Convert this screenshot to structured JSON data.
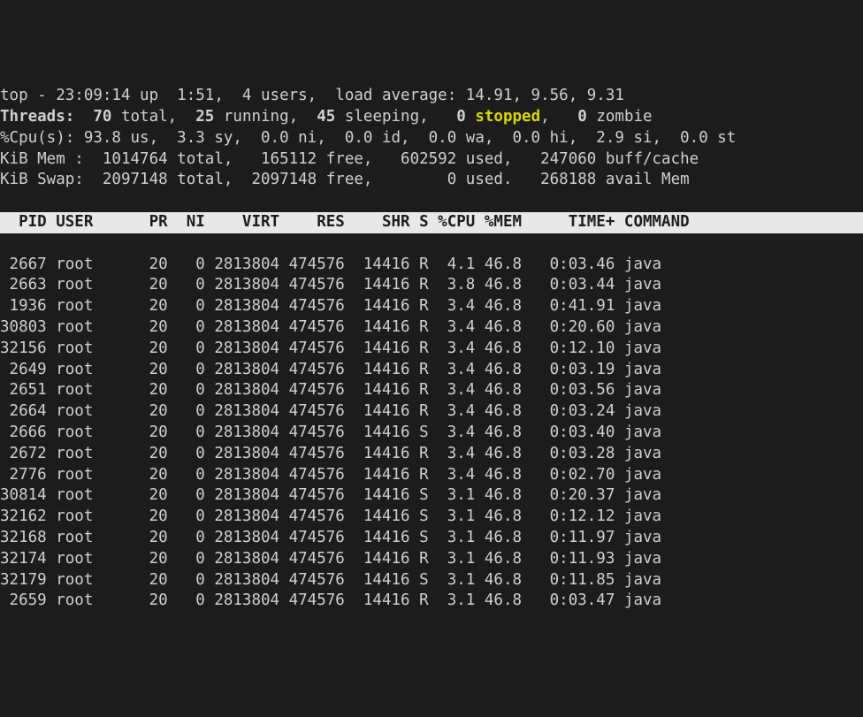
{
  "summary": {
    "line1_a": "top - 23:09:14 up  1:51,  4 users,  load average: 14.91, 9.56, 9.31",
    "line2_a": "Threads:  ",
    "line2_b": "70 ",
    "line2_c": "total,  ",
    "line2_d": "25 ",
    "line2_e": "running,  ",
    "line2_f": "45 ",
    "line2_g": "sleeping,   ",
    "line2_h": "0 ",
    "line2_i": "stopped",
    "line2_j": ",   ",
    "line2_k": "0 ",
    "line2_l": "zombie",
    "line3": "%Cpu(s): 93.8 us,  3.3 sy,  0.0 ni,  0.0 id,  0.0 wa,  0.0 hi,  2.9 si,  0.0 st",
    "line4": "KiB Mem :  1014764 total,   165112 free,   602592 used,   247060 buff/cache",
    "line5": "KiB Swap:  2097148 total,  2097148 free,        0 used.   268188 avail Mem ",
    "blank": ""
  },
  "header": "  PID USER      PR  NI    VIRT    RES    SHR S %CPU %MEM     TIME+ COMMAND                ",
  "rows": [
    " 2667 root      20   0 2813804 474576  14416 R  4.1 46.8   0:03.46 java",
    " 2663 root      20   0 2813804 474576  14416 R  3.8 46.8   0:03.44 java",
    " 1936 root      20   0 2813804 474576  14416 R  3.4 46.8   0:41.91 java",
    "30803 root      20   0 2813804 474576  14416 R  3.4 46.8   0:20.60 java",
    "32156 root      20   0 2813804 474576  14416 R  3.4 46.8   0:12.10 java",
    " 2649 root      20   0 2813804 474576  14416 R  3.4 46.8   0:03.19 java",
    " 2651 root      20   0 2813804 474576  14416 R  3.4 46.8   0:03.56 java",
    " 2664 root      20   0 2813804 474576  14416 R  3.4 46.8   0:03.24 java",
    " 2666 root      20   0 2813804 474576  14416 S  3.4 46.8   0:03.40 java",
    " 2672 root      20   0 2813804 474576  14416 R  3.4 46.8   0:03.28 java",
    " 2776 root      20   0 2813804 474576  14416 R  3.4 46.8   0:02.70 java",
    "30814 root      20   0 2813804 474576  14416 S  3.1 46.8   0:20.37 java",
    "32162 root      20   0 2813804 474576  14416 S  3.1 46.8   0:12.12 java",
    "32168 root      20   0 2813804 474576  14416 S  3.1 46.8   0:11.97 java",
    "32174 root      20   0 2813804 474576  14416 R  3.1 46.8   0:11.93 java",
    "32179 root      20   0 2813804 474576  14416 S  3.1 46.8   0:11.85 java",
    " 2659 root      20   0 2813804 474576  14416 R  3.1 46.8   0:03.47 java"
  ]
}
